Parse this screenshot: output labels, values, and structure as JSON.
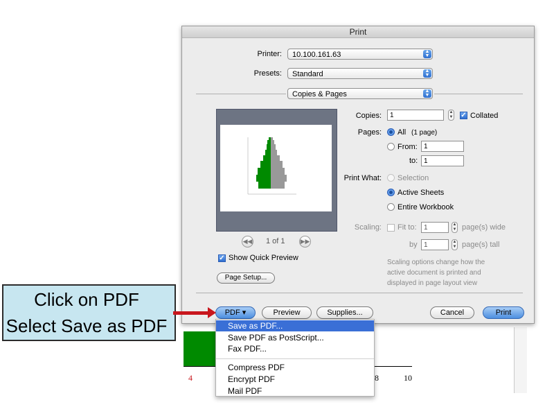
{
  "dialog": {
    "title": "Print",
    "printer_label": "Printer:",
    "printer_value": "10.100.161.63",
    "presets_label": "Presets:",
    "presets_value": "Standard",
    "section_value": "Copies & Pages",
    "copies_label": "Copies:",
    "copies_value": "1",
    "collated_label": "Collated",
    "collated_checked": true,
    "pages_label": "Pages:",
    "all_label": "All",
    "all_note": "(1 page)",
    "from_label": "From:",
    "from_value": "1",
    "to_label": "to:",
    "to_value": "1",
    "print_what_label": "Print What:",
    "selection_label": "Selection",
    "active_sheets_label": "Active Sheets",
    "entire_workbook_label": "Entire Workbook",
    "scaling_label": "Scaling:",
    "fit_to_label": "Fit to:",
    "fit_wide_value": "1",
    "wide_label": "page(s) wide",
    "by_label": "by",
    "fit_tall_value": "1",
    "tall_label": "page(s) tall",
    "scaling_note": "Scaling options change how the active document is printed and displayed in page layout view",
    "page_indicator": "1 of 1",
    "show_preview_label": "Show Quick Preview",
    "page_setup_label": "Page Setup...",
    "pdf_label": "PDF ▾",
    "preview_label": "Preview",
    "supplies_label": "Supplies...",
    "cancel_label": "Cancel",
    "print_label": "Print"
  },
  "pdf_menu": {
    "items": [
      "Save as PDF...",
      "Save PDF as PostScript...",
      "Fax PDF...",
      "Compress PDF",
      "Encrypt PDF",
      "Mail PDF"
    ],
    "selected_index": 0
  },
  "background": {
    "tick_labels": [
      "4",
      "8",
      "10"
    ]
  },
  "callout": {
    "line1": "Click on PDF",
    "line2": "Select Save as PDF",
    "fill_color": "#c7e6f0",
    "arrow_color": "#c8161d"
  },
  "colors": {
    "accent_blue": "#3a6fd6",
    "chart_green": "#008a00"
  }
}
